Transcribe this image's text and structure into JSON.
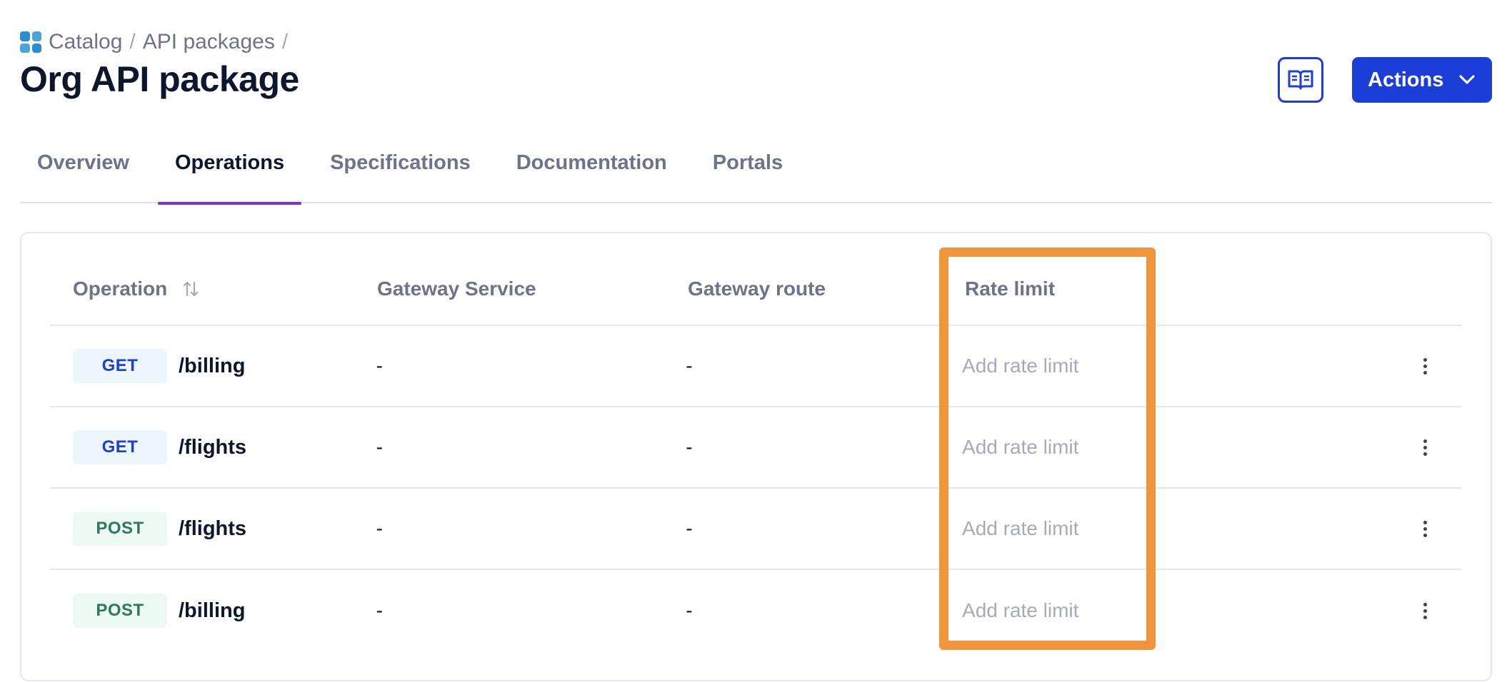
{
  "breadcrumb": {
    "items": [
      "Catalog",
      "API packages"
    ],
    "separator": "/"
  },
  "page": {
    "title": "Org API package"
  },
  "header": {
    "actions_label": "Actions",
    "doc_icon": "book-icon",
    "actions_icon": "chevron-down-icon"
  },
  "tabs": [
    {
      "label": "Overview",
      "active": false
    },
    {
      "label": "Operations",
      "active": true
    },
    {
      "label": "Specifications",
      "active": false
    },
    {
      "label": "Documentation",
      "active": false
    },
    {
      "label": "Portals",
      "active": false
    }
  ],
  "table": {
    "headers": {
      "operation": "Operation",
      "gateway_service": "Gateway Service",
      "gateway_route": "Gateway route",
      "rate_limit": "Rate limit"
    },
    "rows": [
      {
        "method": "GET",
        "path": "/billing",
        "gateway_service": "-",
        "gateway_route": "-",
        "rate_limit": "Add rate limit"
      },
      {
        "method": "GET",
        "path": "/flights",
        "gateway_service": "-",
        "gateway_route": "-",
        "rate_limit": "Add rate limit"
      },
      {
        "method": "POST",
        "path": "/flights",
        "gateway_service": "-",
        "gateway_route": "-",
        "rate_limit": "Add rate limit"
      },
      {
        "method": "POST",
        "path": "/billing",
        "gateway_service": "-",
        "gateway_route": "-",
        "rate_limit": "Add rate limit"
      }
    ]
  },
  "colors": {
    "primary": "#1b3ed9",
    "active_tab_underline": "#7a2ee0",
    "highlight": "#f2943a",
    "get_badge_bg": "#eef6fd",
    "post_badge_bg": "#ecfaf3",
    "post_text": "#2e7a56"
  }
}
